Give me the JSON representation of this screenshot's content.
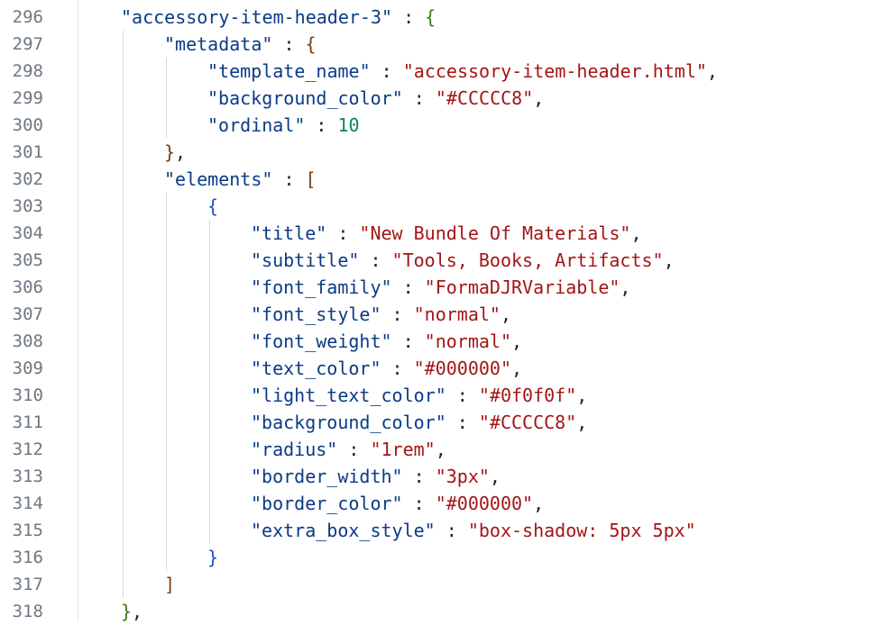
{
  "editor": {
    "lines": [
      {
        "num": "296",
        "indent": 0,
        "tokens": [
          {
            "t": "\"accessory-item-header-3\"",
            "c": "key"
          },
          {
            "t": " : ",
            "c": "punc"
          },
          {
            "t": "{",
            "c": "b1"
          }
        ]
      },
      {
        "num": "297",
        "indent": 1,
        "tokens": [
          {
            "t": "\"metadata\"",
            "c": "key"
          },
          {
            "t": " : ",
            "c": "punc"
          },
          {
            "t": "{",
            "c": "b2"
          }
        ]
      },
      {
        "num": "298",
        "indent": 2,
        "tokens": [
          {
            "t": "\"template_name\"",
            "c": "key"
          },
          {
            "t": " : ",
            "c": "punc"
          },
          {
            "t": "\"accessory-item-header.html\"",
            "c": "str"
          },
          {
            "t": ",",
            "c": "punc"
          }
        ]
      },
      {
        "num": "299",
        "indent": 2,
        "tokens": [
          {
            "t": "\"background_color\"",
            "c": "key"
          },
          {
            "t": " : ",
            "c": "punc"
          },
          {
            "t": "\"#CCCCC8\"",
            "c": "str"
          },
          {
            "t": ",",
            "c": "punc"
          }
        ]
      },
      {
        "num": "300",
        "indent": 2,
        "tokens": [
          {
            "t": "\"ordinal\"",
            "c": "key"
          },
          {
            "t": " : ",
            "c": "punc"
          },
          {
            "t": "10",
            "c": "num"
          }
        ]
      },
      {
        "num": "301",
        "indent": 1,
        "tokens": [
          {
            "t": "}",
            "c": "b2"
          },
          {
            "t": ",",
            "c": "punc"
          }
        ]
      },
      {
        "num": "302",
        "indent": 1,
        "tokens": [
          {
            "t": "\"elements\"",
            "c": "key"
          },
          {
            "t": " : ",
            "c": "punc"
          },
          {
            "t": "[",
            "c": "b2"
          }
        ]
      },
      {
        "num": "303",
        "indent": 2,
        "tokens": [
          {
            "t": "{",
            "c": "b3"
          }
        ]
      },
      {
        "num": "304",
        "indent": 3,
        "tokens": [
          {
            "t": "\"title\"",
            "c": "key"
          },
          {
            "t": " : ",
            "c": "punc"
          },
          {
            "t": "\"New Bundle Of Materials\"",
            "c": "str"
          },
          {
            "t": ",",
            "c": "punc"
          }
        ]
      },
      {
        "num": "305",
        "indent": 3,
        "tokens": [
          {
            "t": "\"subtitle\"",
            "c": "key"
          },
          {
            "t": " : ",
            "c": "punc"
          },
          {
            "t": "\"Tools, Books, Artifacts\"",
            "c": "str"
          },
          {
            "t": ",",
            "c": "punc"
          }
        ]
      },
      {
        "num": "306",
        "indent": 3,
        "tokens": [
          {
            "t": "\"font_family\"",
            "c": "key"
          },
          {
            "t": " : ",
            "c": "punc"
          },
          {
            "t": "\"FormaDJRVariable\"",
            "c": "str"
          },
          {
            "t": ",",
            "c": "punc"
          }
        ]
      },
      {
        "num": "307",
        "indent": 3,
        "tokens": [
          {
            "t": "\"font_style\"",
            "c": "key"
          },
          {
            "t": " : ",
            "c": "punc"
          },
          {
            "t": "\"normal\"",
            "c": "str"
          },
          {
            "t": ",",
            "c": "punc"
          }
        ]
      },
      {
        "num": "308",
        "indent": 3,
        "tokens": [
          {
            "t": "\"font_weight\"",
            "c": "key"
          },
          {
            "t": " : ",
            "c": "punc"
          },
          {
            "t": "\"normal\"",
            "c": "str"
          },
          {
            "t": ",",
            "c": "punc"
          }
        ]
      },
      {
        "num": "309",
        "indent": 3,
        "tokens": [
          {
            "t": "\"text_color\"",
            "c": "key"
          },
          {
            "t": " : ",
            "c": "punc"
          },
          {
            "t": "\"#000000\"",
            "c": "str"
          },
          {
            "t": ",",
            "c": "punc"
          }
        ]
      },
      {
        "num": "310",
        "indent": 3,
        "tokens": [
          {
            "t": "\"light_text_color\"",
            "c": "key"
          },
          {
            "t": " : ",
            "c": "punc"
          },
          {
            "t": "\"#0f0f0f\"",
            "c": "str"
          },
          {
            "t": ",",
            "c": "punc"
          }
        ]
      },
      {
        "num": "311",
        "indent": 3,
        "tokens": [
          {
            "t": "\"background_color\"",
            "c": "key"
          },
          {
            "t": " : ",
            "c": "punc"
          },
          {
            "t": "\"#CCCCC8\"",
            "c": "str"
          },
          {
            "t": ",",
            "c": "punc"
          }
        ]
      },
      {
        "num": "312",
        "indent": 3,
        "tokens": [
          {
            "t": "\"radius\"",
            "c": "key"
          },
          {
            "t": " : ",
            "c": "punc"
          },
          {
            "t": "\"1rem\"",
            "c": "str"
          },
          {
            "t": ",",
            "c": "punc"
          }
        ]
      },
      {
        "num": "313",
        "indent": 3,
        "tokens": [
          {
            "t": "\"border_width\"",
            "c": "key"
          },
          {
            "t": " : ",
            "c": "punc"
          },
          {
            "t": "\"3px\"",
            "c": "str"
          },
          {
            "t": ",",
            "c": "punc"
          }
        ]
      },
      {
        "num": "314",
        "indent": 3,
        "tokens": [
          {
            "t": "\"border_color\"",
            "c": "key"
          },
          {
            "t": " : ",
            "c": "punc"
          },
          {
            "t": "\"#000000\"",
            "c": "str"
          },
          {
            "t": ",",
            "c": "punc"
          }
        ]
      },
      {
        "num": "315",
        "indent": 3,
        "tokens": [
          {
            "t": "\"extra_box_style\"",
            "c": "key"
          },
          {
            "t": " : ",
            "c": "punc"
          },
          {
            "t": "\"box-shadow: 5px 5px\"",
            "c": "str"
          }
        ]
      },
      {
        "num": "316",
        "indent": 2,
        "tokens": [
          {
            "t": "}",
            "c": "b3"
          }
        ]
      },
      {
        "num": "317",
        "indent": 1,
        "tokens": [
          {
            "t": "]",
            "c": "b2"
          }
        ]
      },
      {
        "num": "318",
        "indent": 0,
        "tokens": [
          {
            "t": "}",
            "c": "b1"
          },
          {
            "t": ",",
            "c": "punc"
          }
        ]
      }
    ]
  },
  "colors": {
    "key": "#0b3a86",
    "string": "#a31515",
    "number": "#098658",
    "line_number": "#6e7781",
    "background": "#ffffff"
  }
}
